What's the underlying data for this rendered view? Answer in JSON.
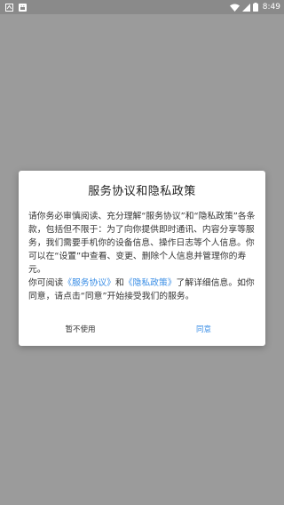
{
  "status_bar": {
    "time": "8:49",
    "icons": [
      "app-notification-icon",
      "android-notification-icon",
      "wifi-icon",
      "battery-icon"
    ]
  },
  "dialog": {
    "title": "服务协议和隐私政策",
    "paragraph1": "请你务必审慎阅读、充分理解“服务协议”和“隐私政策”各条款，包括但不限于：为了向你提供即时通讯、内容分享等服务，我们需要手机你的设备信息、操作日志等个人信息。你可以在“设置”中查看、变更、删除个人信息并管理你的寿元。",
    "paragraph2_prefix": "你可阅读",
    "link_service": "《服务协议》",
    "paragraph2_and": "和",
    "link_privacy": "《隐私政策》",
    "paragraph2_suffix": "了解详细信息。如你同意，请点击“同意”开始接受我们的服务。",
    "decline_label": "暂不使用",
    "agree_label": "同意"
  },
  "colors": {
    "accent": "#3a8ee6",
    "overlay": "#9b9b9b",
    "status_bar": "#8a8a8a"
  }
}
